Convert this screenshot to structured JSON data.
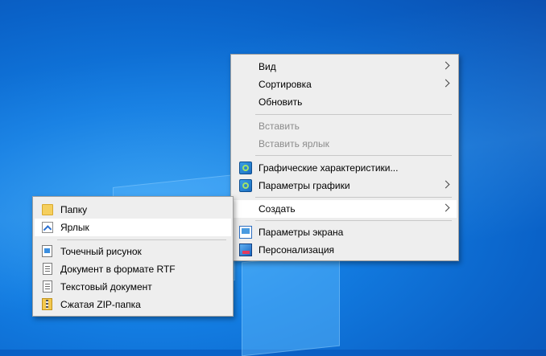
{
  "context_menu": {
    "items": [
      {
        "label": "Вид",
        "has_submenu": true,
        "enabled": true
      },
      {
        "label": "Сортировка",
        "has_submenu": true,
        "enabled": true
      },
      {
        "label": "Обновить",
        "has_submenu": false,
        "enabled": true
      },
      {
        "label": "Вставить",
        "has_submenu": false,
        "enabled": false
      },
      {
        "label": "Вставить ярлык",
        "has_submenu": false,
        "enabled": false
      },
      {
        "label": "Графические характеристики...",
        "icon": "graphics-icon",
        "has_submenu": false,
        "enabled": true
      },
      {
        "label": "Параметры графики",
        "icon": "graphics-icon",
        "has_submenu": true,
        "enabled": true
      },
      {
        "label": "Создать",
        "has_submenu": true,
        "enabled": true,
        "highlighted": true
      },
      {
        "label": "Параметры экрана",
        "icon": "display-icon",
        "has_submenu": false,
        "enabled": true
      },
      {
        "label": "Персонализация",
        "icon": "personalization-icon",
        "has_submenu": false,
        "enabled": true
      }
    ]
  },
  "create_submenu": {
    "items": [
      {
        "label": "Папку",
        "icon": "folder-icon"
      },
      {
        "label": "Ярлык",
        "icon": "shortcut-icon",
        "highlighted": true
      },
      {
        "label": "Точечный рисунок",
        "icon": "bitmap-icon"
      },
      {
        "label": "Документ в формате RTF",
        "icon": "rtf-document-icon"
      },
      {
        "label": "Текстовый документ",
        "icon": "text-document-icon"
      },
      {
        "label": "Сжатая ZIP-папка",
        "icon": "zip-folder-icon"
      }
    ]
  }
}
